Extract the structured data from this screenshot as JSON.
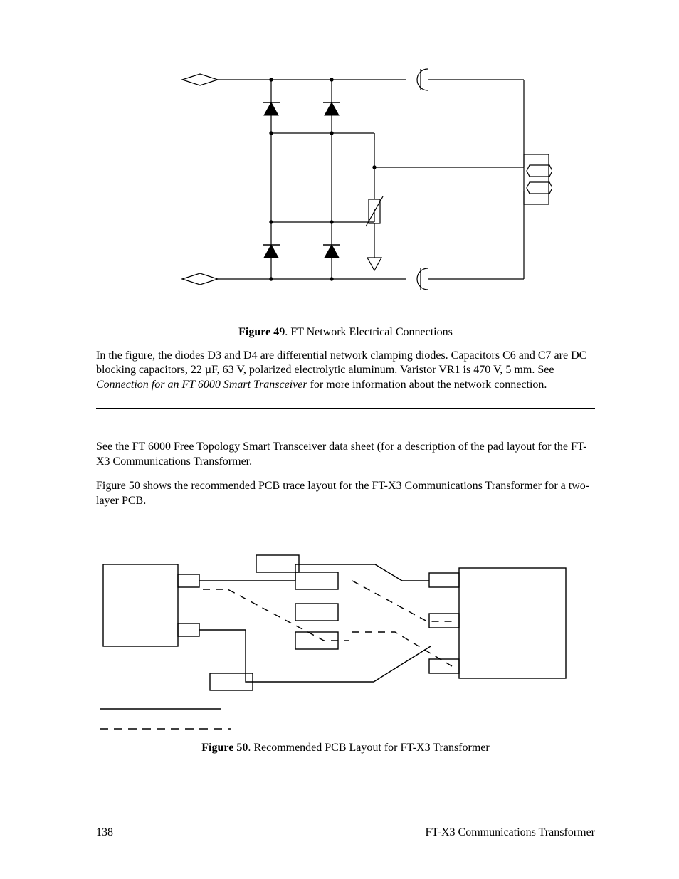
{
  "figure49": {
    "label": "Figure 49",
    "caption": ". FT Network Electrical Connections"
  },
  "para1_parts": {
    "a": "In the figure, the diodes D3 and D4 are differential network clamping diodes.  Capacitors C6 and C7 are DC blocking capacitors, 22 µF, 63 V, polarized electrolytic aluminum.  Varistor VR1 is 470 V, 5 mm.  See ",
    "b": "Connection for an FT 6000 Smart Transceiver",
    "c": " for more information about the network connection."
  },
  "para2": "See the FT 6000 Free Topology Smart Transceiver data sheet (for a description of the pad layout for  the FT-X3 Communications Transformer.",
  "para3": "Figure 50 shows the recommended PCB trace layout for the FT-X3 Communications Transformer for a two-layer PCB.",
  "figure50": {
    "label": "Figure 50",
    "caption": ". Recommended PCB Layout for FT-X3 Transformer"
  },
  "footer": {
    "page": "138",
    "title": "FT-X3 Communications Transformer"
  }
}
